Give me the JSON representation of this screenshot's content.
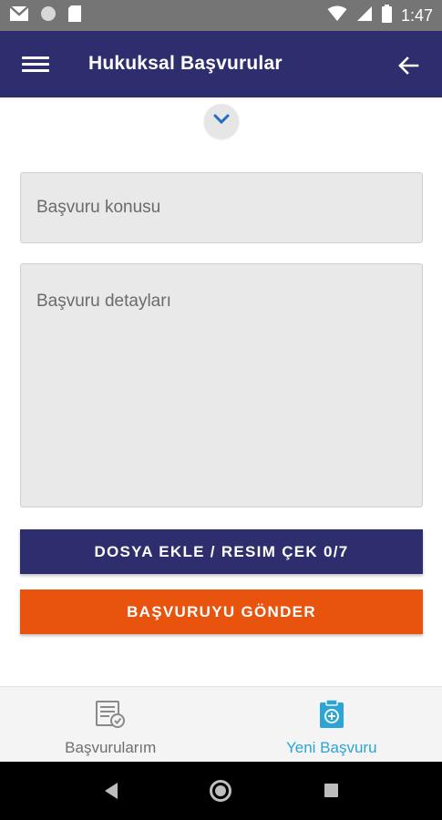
{
  "status_bar": {
    "time": "1:47",
    "icons": [
      "gmail-icon",
      "circle-icon",
      "sd-card-icon",
      "wifi-icon",
      "signal-icon",
      "battery-icon"
    ]
  },
  "app_bar": {
    "title": "Hukuksal Başvurular",
    "menu_icon": "hamburger-menu-icon",
    "back_icon": "arrow-left-icon",
    "background": "#2e2e6e"
  },
  "form": {
    "subject_placeholder": "Başvuru konusu",
    "details_placeholder": "Başvuru detayları",
    "attach_button": "DOSYA EKLE / RESIM ÇEK 0/7",
    "send_button": "BAŞVURUYU GÖNDER",
    "attach_color": "#2e2e6e",
    "send_color": "#e8530e"
  },
  "bottom_nav": {
    "items": [
      {
        "label": "Başvurularım",
        "icon": "applications-list-icon",
        "active": false
      },
      {
        "label": "Yeni Başvuru",
        "icon": "new-application-icon",
        "active": true
      }
    ],
    "active_color": "#2aa5d6"
  }
}
